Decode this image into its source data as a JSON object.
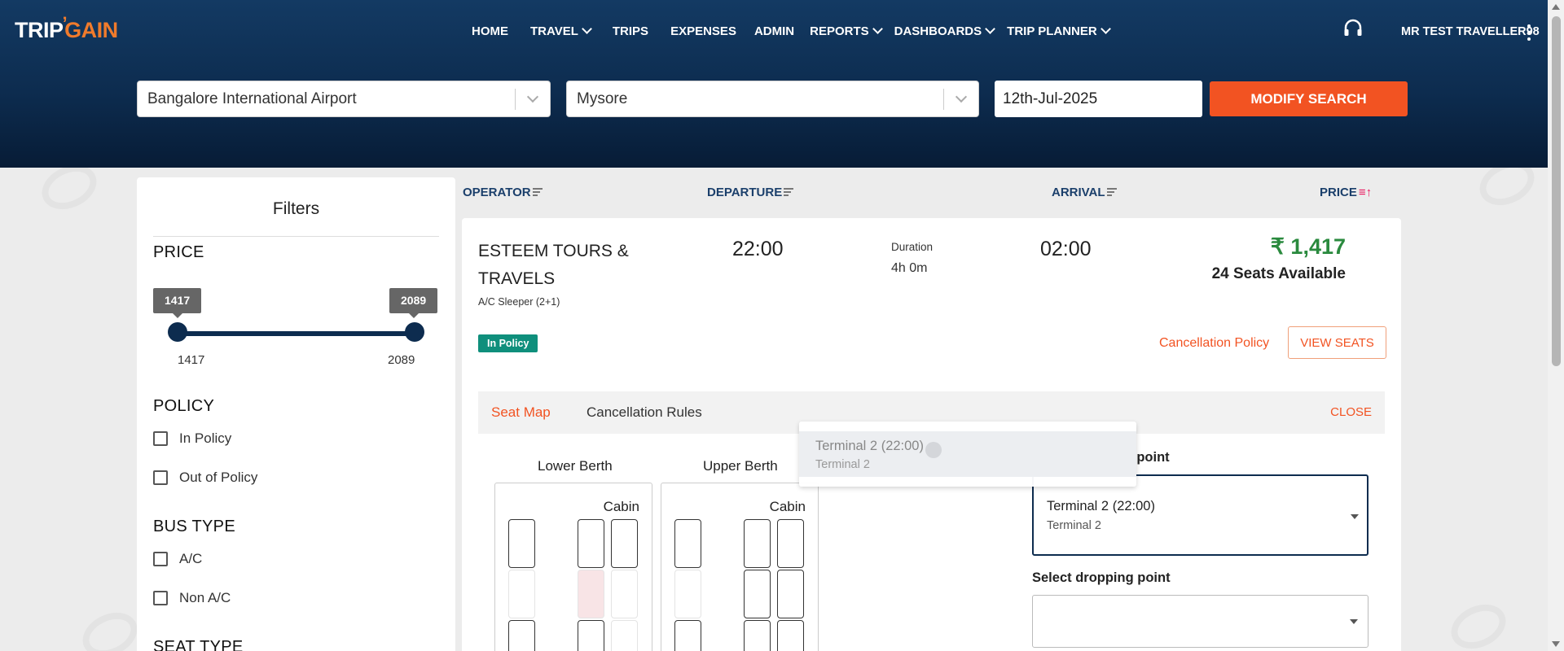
{
  "header": {
    "logo_part1": "TRIP",
    "logo_part2": "GAIN",
    "nav": [
      {
        "label": "HOME",
        "dropdown": false
      },
      {
        "label": "TRAVEL",
        "dropdown": true
      },
      {
        "label": "TRIPS",
        "dropdown": false
      },
      {
        "label": "EXPENSES",
        "dropdown": false
      },
      {
        "label": "ADMIN",
        "dropdown": false
      },
      {
        "label": "REPORTS",
        "dropdown": true
      },
      {
        "label": "DASHBOARDS",
        "dropdown": true
      },
      {
        "label": "TRIP PLANNER",
        "dropdown": true
      }
    ],
    "user_name": "MR TEST TRAVELLER98"
  },
  "search": {
    "from": "Bangalore International Airport",
    "to": "Mysore",
    "date": "12th-Jul-2025",
    "modify_label": "MODIFY SEARCH"
  },
  "filters": {
    "title": "Filters",
    "price": {
      "heading": "PRICE",
      "min": "1417",
      "max": "2089",
      "selected_min": "1417",
      "selected_max": "2089"
    },
    "policy": {
      "heading": "POLICY",
      "options": [
        {
          "label": "In Policy",
          "checked": false
        },
        {
          "label": "Out of Policy",
          "checked": false
        }
      ]
    },
    "bus_type": {
      "heading": "BUS TYPE",
      "options": [
        {
          "label": "A/C",
          "checked": false
        },
        {
          "label": "Non A/C",
          "checked": false
        }
      ]
    },
    "seat_type": {
      "heading": "SEAT TYPE"
    }
  },
  "sort": {
    "operator": "OPERATOR",
    "departure": "DEPARTURE",
    "arrival": "ARRIVAL",
    "price": "PRICE"
  },
  "bus": {
    "operator": "ESTEEM TOURS & TRAVELS",
    "bus_type": "A/C Sleeper (2+1)",
    "policy_badge": "In Policy",
    "departure": "22:00",
    "duration_label": "Duration",
    "duration": "4h 0m",
    "arrival": "02:00",
    "price": "₹ 1,417",
    "seats_available": "24 Seats Available",
    "cancellation_link": "Cancellation Policy",
    "view_seats": "VIEW SEATS"
  },
  "seat_panel": {
    "tab_seat_map": "Seat Map",
    "tab_cancellation": "Cancellation Rules",
    "close": "CLOSE",
    "lower_berth": "Lower Berth",
    "upper_berth": "Upper Berth",
    "cabin": "Cabin",
    "boarding_label": "Select boarding point",
    "boarding_selected": "Terminal 2 (22:00)",
    "boarding_selected_sub": "Terminal 2",
    "dropping_label": "Select dropping point",
    "dropdown_option": "Terminal 2 (22:00)",
    "dropdown_option_sub": "Terminal 2"
  },
  "colors": {
    "header_bg": "#0d2c4f",
    "accent": "#f25322",
    "price_green": "#2a8a3e",
    "policy_badge": "#0f8f7c"
  }
}
